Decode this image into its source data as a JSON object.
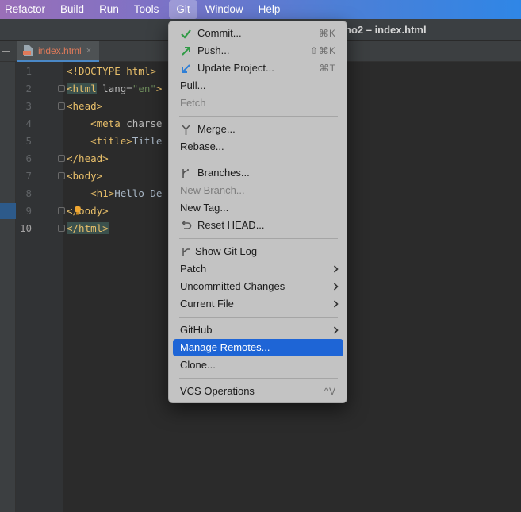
{
  "menubar": {
    "items": [
      "Refactor",
      "Build",
      "Run",
      "Tools",
      "Git",
      "Window",
      "Help"
    ]
  },
  "window": {
    "title": "no2 – index.html"
  },
  "tab": {
    "label": "index.html",
    "close": "×"
  },
  "editor": {
    "line_numbers": [
      "1",
      "2",
      "3",
      "4",
      "5",
      "6",
      "7",
      "8",
      "9",
      "10"
    ]
  },
  "git_menu": {
    "commit": {
      "label": "Commit...",
      "shortcut": "⌘K",
      "icon": "commit-check-icon"
    },
    "push": {
      "label": "Push...",
      "shortcut": "⇧⌘K",
      "icon": "push-arrow-icon"
    },
    "update": {
      "label": "Update Project...",
      "shortcut": "⌘T",
      "icon": "update-arrow-icon"
    },
    "pull": {
      "label": "Pull..."
    },
    "fetch": {
      "label": "Fetch"
    },
    "merge": {
      "label": "Merge...",
      "icon": "merge-icon"
    },
    "rebase": {
      "label": "Rebase..."
    },
    "branches": {
      "label": "Branches...",
      "icon": "branch-icon"
    },
    "new_branch": {
      "label": "New Branch..."
    },
    "new_tag": {
      "label": "New Tag..."
    },
    "reset_head": {
      "label": "Reset HEAD...",
      "icon": "reset-icon"
    },
    "show_log": {
      "label": "Show Git Log",
      "icon": "git-log-icon"
    },
    "patch": {
      "label": "Patch"
    },
    "uncommitted": {
      "label": "Uncommitted Changes"
    },
    "current_file": {
      "label": "Current File"
    },
    "github": {
      "label": "GitHub"
    },
    "manage_remotes": {
      "label": "Manage Remotes..."
    },
    "clone": {
      "label": "Clone..."
    },
    "vcs_ops": {
      "label": "VCS Operations",
      "shortcut": "^V"
    }
  },
  "colors": {
    "selection": "#1e65d6",
    "menu_background": "#c3c3c3",
    "editor_background": "#2b2b2b",
    "tag": "#e8bf6a",
    "string": "#6a8759"
  }
}
